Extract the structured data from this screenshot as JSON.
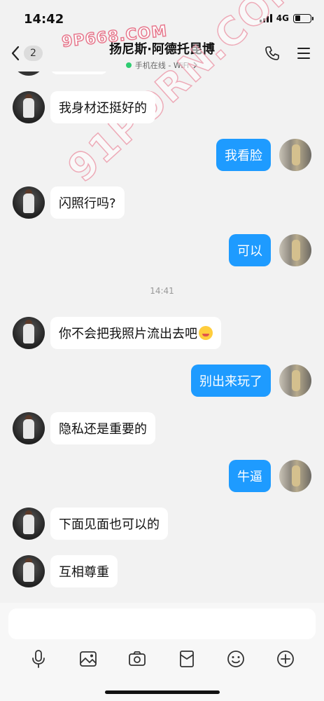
{
  "status": {
    "time": "14:42",
    "network": "4G",
    "battery_level": 0.35
  },
  "header": {
    "back_count": "2",
    "title": "扬尼斯·阿德托昆博",
    "subtitle": "手机在线 - WiFi"
  },
  "watermarks": {
    "top": "9P668.COM",
    "diagonal": "91PORN.COM"
  },
  "messages": [
    {
      "side": "left",
      "text": "我身材还挺好的"
    },
    {
      "side": "right",
      "text": "我看脸"
    },
    {
      "side": "left",
      "text": "闪照行吗?"
    },
    {
      "side": "right",
      "text": "可以"
    },
    {
      "side": "time",
      "text": "14:41"
    },
    {
      "side": "left",
      "text": "你不会把我照片流出去吧"
    },
    {
      "side": "right",
      "text": "别出来玩了"
    },
    {
      "side": "left",
      "text": "隐私还是重要的"
    },
    {
      "side": "right",
      "text": "牛逼"
    },
    {
      "side": "left",
      "text": "下面见面也可以的"
    },
    {
      "side": "left",
      "text": "互相尊重"
    }
  ],
  "input": {
    "placeholder": ""
  },
  "icons": {
    "status": [
      "signal-icon",
      "battery-icon"
    ],
    "header": [
      "back-icon",
      "chevron-right-icon",
      "phone-icon",
      "menu-icon"
    ],
    "toolbar": [
      "microphone-icon",
      "image-icon",
      "camera-icon",
      "red-packet-icon",
      "emoji-icon",
      "plus-icon"
    ],
    "emoji_in_message": "tongue-out-emoji"
  },
  "colors": {
    "outgoing_bubble": "#1e9bff",
    "incoming_bubble": "#ffffff",
    "online_dot": "#2ecc71",
    "background": "#f2f2f2"
  }
}
